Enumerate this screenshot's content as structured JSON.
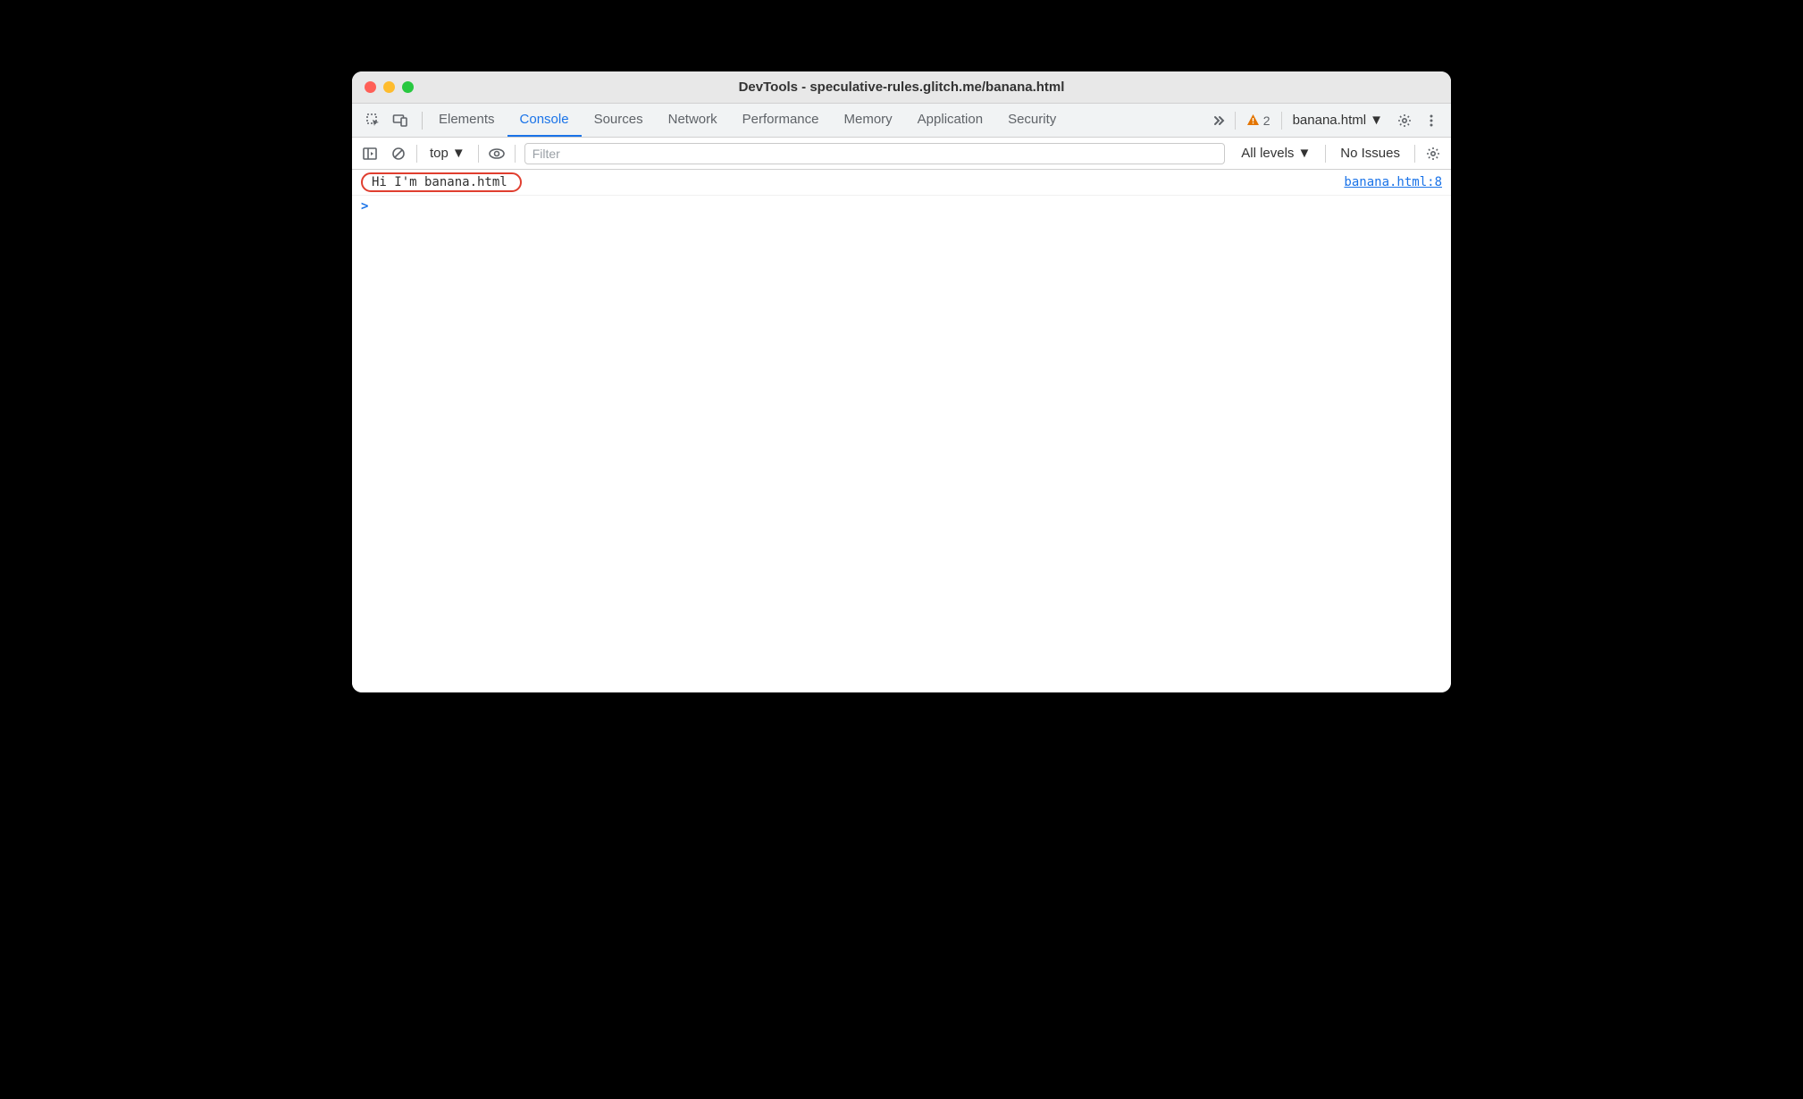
{
  "window": {
    "title": "DevTools - speculative-rules.glitch.me/banana.html"
  },
  "tabs": {
    "items": [
      {
        "label": "Elements"
      },
      {
        "label": "Console"
      },
      {
        "label": "Sources"
      },
      {
        "label": "Network"
      },
      {
        "label": "Performance"
      },
      {
        "label": "Memory"
      },
      {
        "label": "Application"
      },
      {
        "label": "Security"
      }
    ],
    "active_index": 1,
    "warning_count": "2",
    "target_label": "banana.html"
  },
  "toolbar": {
    "context_label": "top",
    "filter_placeholder": "Filter",
    "levels_label": "All levels",
    "issues_label": "No Issues"
  },
  "console": {
    "log_message": "Hi I'm banana.html",
    "log_source": "banana.html:8",
    "prompt": ">"
  }
}
